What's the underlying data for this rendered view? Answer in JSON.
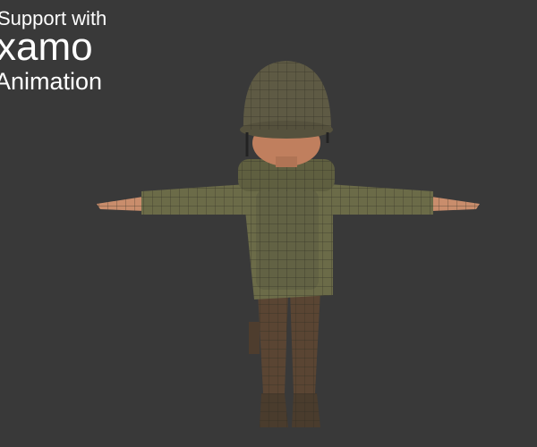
{
  "overlay": {
    "line1": "Support with",
    "line2": "xamo",
    "line3": "Animation"
  },
  "colors": {
    "background": "#393939",
    "uniform": "#6b6b48",
    "helmet": "#5e5a44",
    "trousers": "#5a4533",
    "skin": "#c98d6c",
    "wire": "#2c2a22"
  }
}
